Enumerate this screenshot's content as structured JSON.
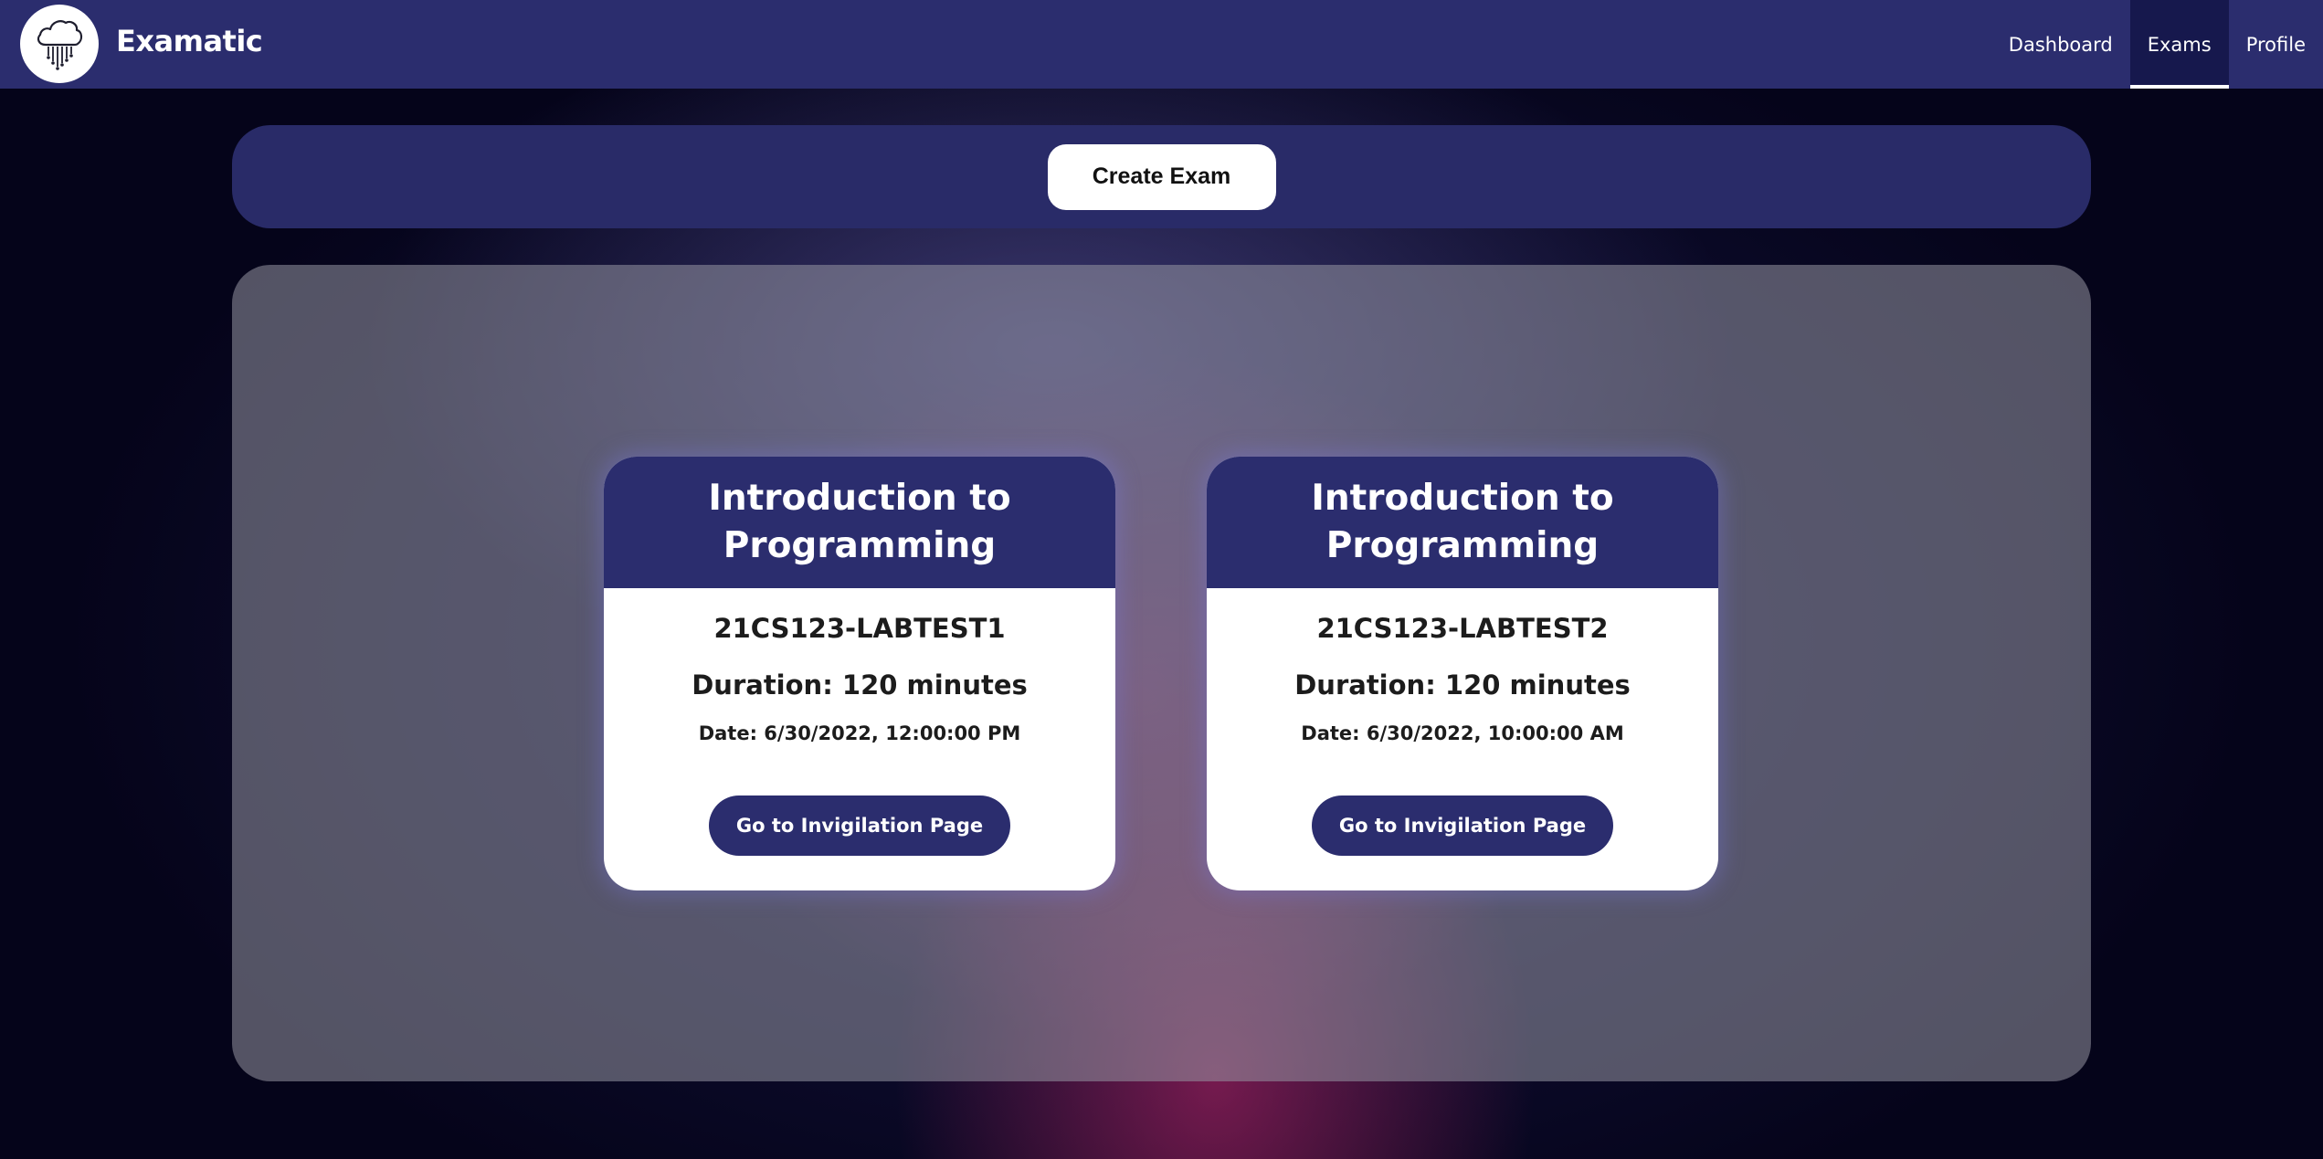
{
  "navbar": {
    "brand": "Examatic",
    "logo_icon": "cloud-icon",
    "links": [
      {
        "label": "Dashboard",
        "active": false
      },
      {
        "label": "Exams",
        "active": true
      },
      {
        "label": "Profile",
        "active": false
      }
    ]
  },
  "toolbar": {
    "create_label": "Create Exam"
  },
  "exams": [
    {
      "title": "Introduction to Programming",
      "code": "21CS123-LABTEST1",
      "duration": "Duration: 120 minutes",
      "date": "Date: 6/30/2022, 12:00:00 PM",
      "action_label": "Go to Invigilation Page"
    },
    {
      "title": "Introduction to Programming",
      "code": "21CS123-LABTEST2",
      "duration": "Duration: 120 minutes",
      "date": "Date: 6/30/2022, 10:00:00 AM",
      "action_label": "Go to Invigilation Page"
    }
  ],
  "colors": {
    "primary": "#2b2d6e",
    "nav_active": "#16184d",
    "card_bg": "#ffffff",
    "page_bg": "#05041a"
  }
}
